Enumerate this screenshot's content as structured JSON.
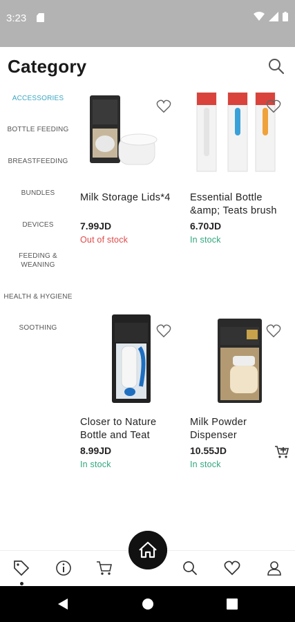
{
  "status": {
    "time": "3:23"
  },
  "header": {
    "title": "Category"
  },
  "sidebar": {
    "items": [
      {
        "label": "ACCESSORIES"
      },
      {
        "label": "BOTTLE FEEDING"
      },
      {
        "label": "BREASTFEEDING"
      },
      {
        "label": "BUNDLES"
      },
      {
        "label": "DEVICES"
      },
      {
        "label": "FEEDING &",
        "label2": "WEANING"
      },
      {
        "label": "HEALTH & HYGIENE"
      },
      {
        "label": "SOOTHING"
      }
    ]
  },
  "products": [
    {
      "name": "Milk Storage Lids*4",
      "name2": "",
      "price": "7.99JD",
      "stock": "Out of stock"
    },
    {
      "name": "Essential Bottle",
      "name2": "&amp; Teats brush",
      "price": "6.70JD",
      "stock": "In stock"
    },
    {
      "name": "Closer to Nature",
      "name2": "Bottle and Teat",
      "price": "8.99JD",
      "stock": "In stock"
    },
    {
      "name": "Milk Powder",
      "name2": "Dispenser",
      "price": "10.55JD",
      "stock": "In stock"
    }
  ],
  "colors": {
    "accent": "#3aa6c2",
    "out_of_stock": "#e04848",
    "in_stock": "#2fa67a"
  }
}
